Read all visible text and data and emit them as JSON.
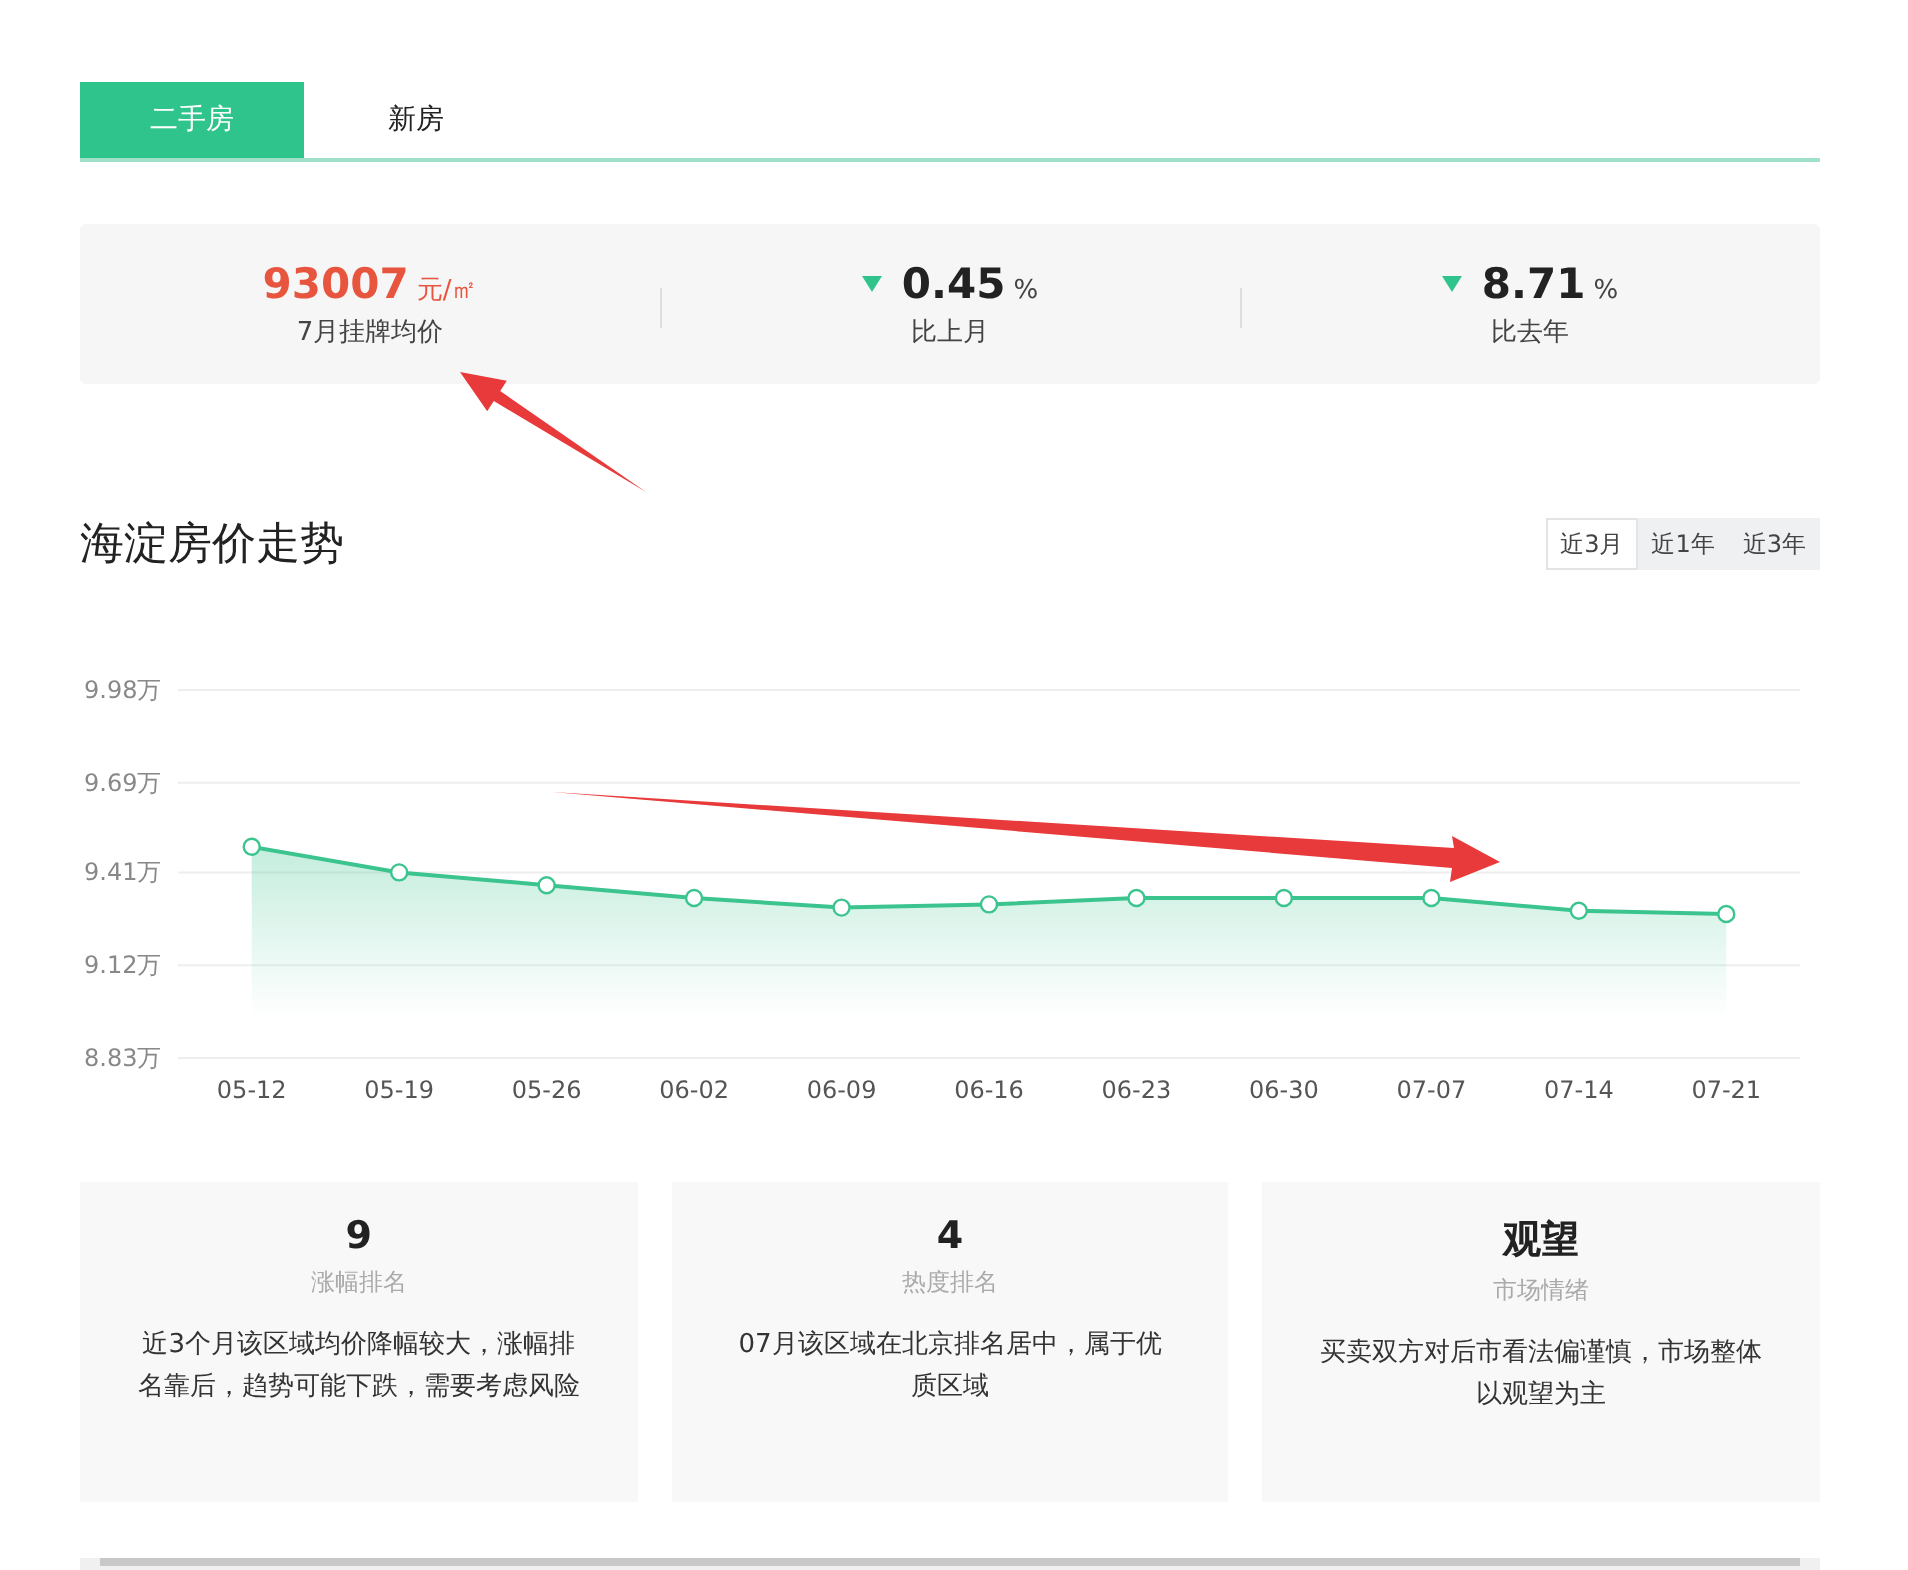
{
  "tabs": [
    {
      "label": "二手房",
      "selected": true
    },
    {
      "label": "新房",
      "selected": false
    }
  ],
  "stats": [
    {
      "value": "93007",
      "unit": "元/㎡",
      "label": "7月挂牌均价",
      "kind": "price"
    },
    {
      "value": "0.45",
      "unit": "%",
      "label": "比上月",
      "kind": "down"
    },
    {
      "value": "8.71",
      "unit": "%",
      "label": "比去年",
      "kind": "down"
    }
  ],
  "trend": {
    "title": "海淀房价走势",
    "ranges": [
      {
        "label": "近3月",
        "selected": true
      },
      {
        "label": "近1年",
        "selected": false
      },
      {
        "label": "近3年",
        "selected": false
      }
    ],
    "chart_data": {
      "type": "area",
      "categories": [
        "05-12",
        "05-19",
        "05-26",
        "06-02",
        "06-09",
        "06-16",
        "06-23",
        "06-30",
        "07-07",
        "07-14",
        "07-21"
      ],
      "grid": true,
      "series": [
        {
          "color": "#3cc48f",
          "values": [
            9.49,
            9.41,
            9.37,
            9.33,
            9.3,
            9.31,
            9.33,
            9.33,
            9.33,
            9.29,
            9.28
          ]
        }
      ],
      "ylim": [
        8.83,
        9.98
      ],
      "yticks": [
        {
          "value": 8.83,
          "label": "8.83万"
        },
        {
          "value": 9.12,
          "label": "9.12万"
        },
        {
          "value": 9.41,
          "label": "9.41万"
        },
        {
          "value": 9.69,
          "label": "9.69万"
        },
        {
          "value": 9.98,
          "label": "9.98万"
        }
      ]
    }
  },
  "cards": [
    {
      "value": "9",
      "label": "涨幅排名",
      "text": "近3个月该区域均价降幅较大，涨幅排名靠后，趋势可能下跌，需要考虑风险"
    },
    {
      "value": "4",
      "label": "热度排名",
      "text": "07月该区域在北京排名居中，属于优质区域"
    },
    {
      "value": "观望",
      "label": "市场情绪",
      "text": "买卖双方对后市看法偏谨慎，市场整体以观望为主"
    }
  ]
}
